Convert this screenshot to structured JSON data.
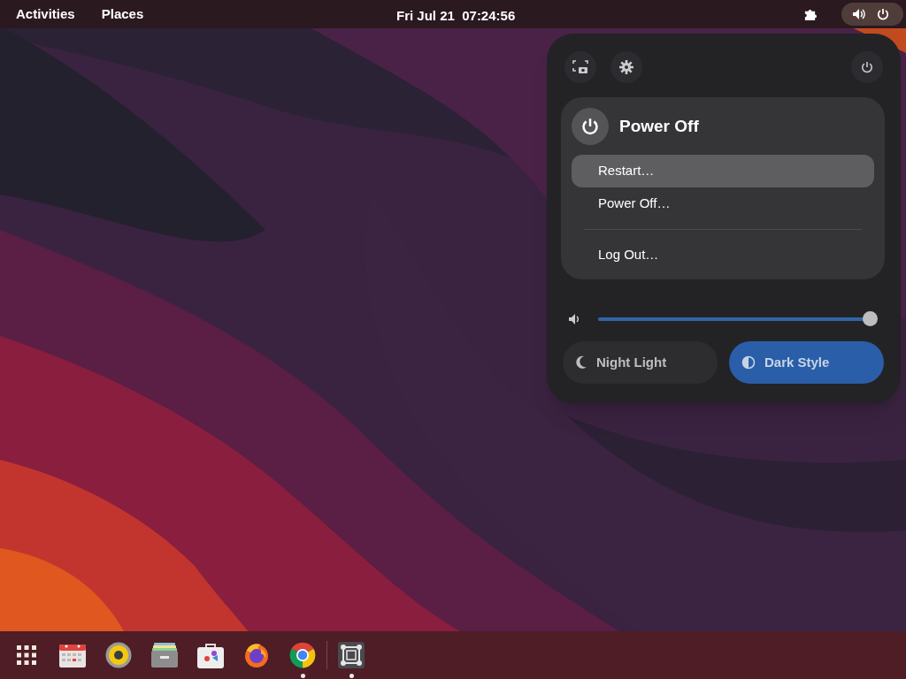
{
  "top_bar": {
    "activities": "Activities",
    "places": "Places",
    "clock": "Fri Jul 21  07:24:56"
  },
  "quick_settings": {
    "power_menu": {
      "title": "Power Off",
      "items": [
        {
          "label": "Restart…",
          "selected": true
        },
        {
          "label": "Power Off…",
          "selected": false
        }
      ],
      "session_items": [
        {
          "label": "Log Out…",
          "selected": false
        }
      ]
    },
    "volume": {
      "level": 1
    },
    "toggles": [
      {
        "kind": "night",
        "label": "Night Light",
        "on": false
      },
      {
        "kind": "dark",
        "label": "Dark Style",
        "on": true
      }
    ]
  },
  "dock": {
    "apps": [
      {
        "kind": "grid",
        "running": false
      },
      {
        "kind": "calendar",
        "running": false
      },
      {
        "kind": "speaker",
        "running": false
      },
      {
        "kind": "cabinet",
        "running": false
      },
      {
        "kind": "bag",
        "running": false
      },
      {
        "kind": "flame",
        "running": false
      },
      {
        "kind": "ring",
        "running": true
      }
    ],
    "extra_apps": [
      {
        "kind": "frame",
        "running": true
      }
    ]
  }
}
